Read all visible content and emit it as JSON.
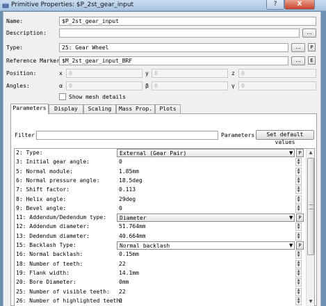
{
  "window": {
    "title": "Primitive Properties: $P_2st_gear_input",
    "help_label": "?",
    "close_label": "X"
  },
  "header": {
    "name_label": "Name:",
    "name_value": "$P_2st_gear_input",
    "description_label": "Description:",
    "description_value": "",
    "browse_label": "...",
    "type_label": "Type:",
    "type_value": "25: Gear Wheel",
    "ref_label": "Reference Marker:",
    "ref_value": "$M_2st_gear_input_BRF",
    "p_label": "P",
    "e_label": "E",
    "position_label": "Position:",
    "angles_label": "Angles:",
    "pos_x_label": "x",
    "pos_x": "0",
    "pos_y_label": "y",
    "pos_y": "0",
    "pos_z_label": "z",
    "pos_z": "0",
    "ang_a_label": "α",
    "ang_a": "0",
    "ang_b_label": "β",
    "ang_b": "0",
    "ang_g_label": "γ",
    "ang_g": "0",
    "mesh_label": "Show mesh details"
  },
  "tabs": [
    "Parameters",
    "Display",
    "Scaling",
    "Mass Prop.",
    "Plots"
  ],
  "filter": {
    "label": "Filter:",
    "value": "",
    "params_label": "Parameters:",
    "default_button": "Set default values"
  },
  "parameters": [
    {
      "name": "2: Type:",
      "value": "External (Gear Pair)",
      "kind": "combo"
    },
    {
      "name": "3: Initial gear angle:",
      "value": "0",
      "kind": "spin"
    },
    {
      "name": "5: Normal module:",
      "value": "1.85mm",
      "kind": "spin"
    },
    {
      "name": "6: Normal pressure angle:",
      "value": "18.5deg",
      "kind": "spin"
    },
    {
      "name": "7: Shift factor:",
      "value": "0.113",
      "kind": "spin"
    },
    {
      "name": "8: Helix angle:",
      "value": "29deg",
      "kind": "spin"
    },
    {
      "name": "9: Bevel angle:",
      "value": "0",
      "kind": "spin"
    },
    {
      "name": "11: Addendum/Dedendum type:",
      "value": "Diameter",
      "kind": "combo"
    },
    {
      "name": "12: Addendum diameter:",
      "value": "51.764mm",
      "kind": "spin"
    },
    {
      "name": "13: Dedendum diameter:",
      "value": "40.664mm",
      "kind": "spin"
    },
    {
      "name": "15: Backlash Type:",
      "value": "Normal backlash",
      "kind": "combo-white"
    },
    {
      "name": "16: Normal backlash:",
      "value": "0.15mm",
      "kind": "spin"
    },
    {
      "name": "18: Number of teeth:",
      "value": "22",
      "kind": "spin"
    },
    {
      "name": "19: Flank width:",
      "value": "14.1mm",
      "kind": "spin"
    },
    {
      "name": "20: Bore Diameter:",
      "value": "0mm",
      "kind": "spin"
    },
    {
      "name": "25: Number of visible teeth:",
      "value": "22",
      "kind": "spin"
    },
    {
      "name": "26: Number of highlighted teeth:",
      "value": "0",
      "kind": "spin"
    }
  ]
}
